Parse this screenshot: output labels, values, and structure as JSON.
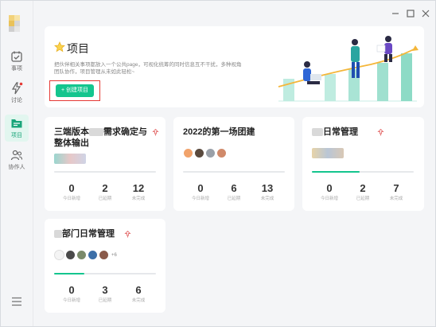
{
  "sidebar": {
    "items": [
      {
        "label": "事项",
        "icon": "calendar-check-icon"
      },
      {
        "label": "讨论",
        "icon": "lightning-chat-icon",
        "badge": true
      },
      {
        "label": "项目",
        "icon": "project-folder-icon",
        "active": true
      },
      {
        "label": "协作人",
        "icon": "people-icon"
      }
    ],
    "menu_icon": "hamburger-menu-icon"
  },
  "window": {
    "controls": [
      "minimize-icon",
      "maximize-icon",
      "close-icon"
    ]
  },
  "hero": {
    "title": "项目",
    "description": "把伙伴相关事项都放入一个公共page，可视化统筹的同时信息互不干扰，多种视角团队协作，项目管理从未如此轻松~",
    "create_button": "+ 创建项目"
  },
  "stat_captions": {
    "today": "今日新增",
    "overdue": "已延期",
    "unfinished": "未完成"
  },
  "projects": [
    {
      "title_part1": "三端版本",
      "title_part2": "需求确定与",
      "title_line2": "整体输出",
      "progress": 0.0,
      "today": "0",
      "overdue": "2",
      "unfinished": "12"
    },
    {
      "title": "2022的第一场团建",
      "progress": 0.0,
      "today": "0",
      "overdue": "6",
      "unfinished": "13"
    },
    {
      "title": "日常管理",
      "progress": 0.47,
      "today": "0",
      "overdue": "2",
      "unfinished": "7"
    },
    {
      "title": "部门日常管理",
      "avatar_more": "+6",
      "progress": 0.3,
      "today": "0",
      "overdue": "3",
      "unfinished": "6"
    }
  ],
  "colors": {
    "accent": "#14c58e",
    "highlight": "#e53935",
    "pin": "#e57373"
  }
}
